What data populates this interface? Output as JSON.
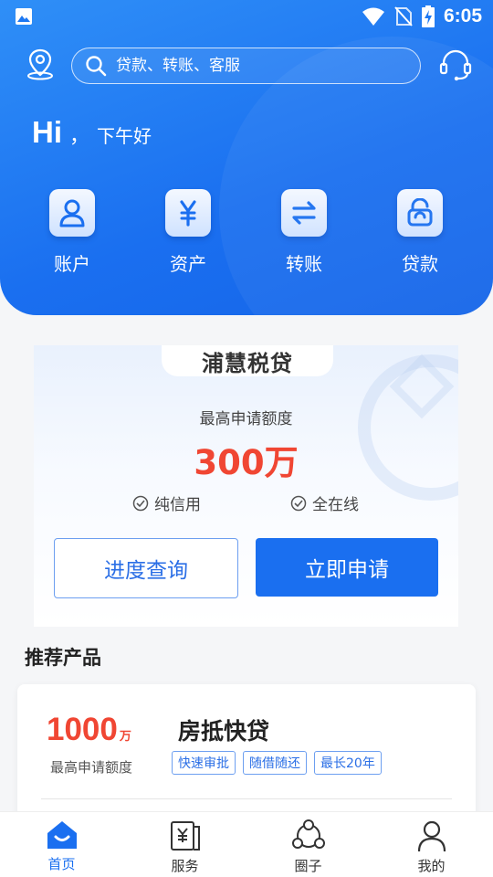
{
  "status_bar": {
    "time": "6:05",
    "icons": [
      "image-icon",
      "wifi-icon",
      "no-sim-icon",
      "battery-charging-icon"
    ]
  },
  "header": {
    "search_placeholder": "贷款、转账、客服",
    "location_icon": "location-icon",
    "service_icon": "headset-icon",
    "greeting_hi": "Hi",
    "greeting_comma": "，",
    "greeting_text": "下午好"
  },
  "quick_actions": [
    {
      "label": "账户",
      "icon": "user-icon"
    },
    {
      "label": "资产",
      "icon": "yuan-icon"
    },
    {
      "label": "转账",
      "icon": "transfer-icon"
    },
    {
      "label": "贷款",
      "icon": "loan-icon"
    }
  ],
  "loan_card": {
    "brand": "浦慧税贷",
    "quota_label": "最高申请额度",
    "quota_value": "300万",
    "features": [
      "纯信用",
      "全在线"
    ],
    "progress_button": "进度查询",
    "apply_button": "立即申请"
  },
  "recommend": {
    "title": "推荐产品",
    "products": [
      {
        "amount": "1000",
        "unit": "万",
        "amount_label": "最高申请额度",
        "name": "房抵快贷",
        "tags": [
          "快速审批",
          "随借随还",
          "最长20年"
        ]
      }
    ]
  },
  "tabbar": {
    "items": [
      {
        "label": "首页",
        "icon": "home-icon",
        "active": true
      },
      {
        "label": "服务",
        "icon": "service-doc-icon",
        "active": false
      },
      {
        "label": "圈子",
        "icon": "circle-network-icon",
        "active": false
      },
      {
        "label": "我的",
        "icon": "profile-icon",
        "active": false
      }
    ]
  },
  "colors": {
    "primary": "#1a6ff0",
    "accent_red": "#f04633",
    "header_gradient_start": "#2f8ff7"
  }
}
